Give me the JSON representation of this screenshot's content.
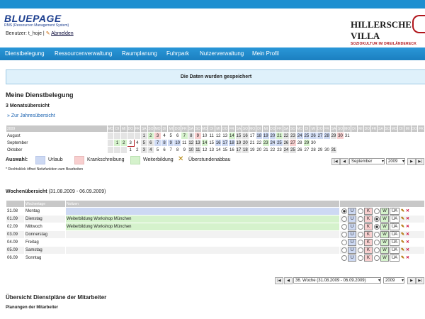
{
  "header": {
    "logo_text": "BLUEPAGE",
    "logo_sub": "RMS (Ressourcen Management System)",
    "user_label": "Benutzer: t_hoje |",
    "logout_label": "Abmelden",
    "brand_title": "HILLERSCHE VILLA",
    "brand_sub": "SOZIOKULTUR IM DREILÄNDERECK"
  },
  "nav": [
    "Dienstbelegung",
    "Ressourcenverwaltung",
    "Raumplanung",
    "Fuhrpark",
    "Nutzerverwaltung",
    "Mein Profil"
  ],
  "message": "Die Daten wurden gespeichert",
  "page_title": "Meine Dienstbelegung",
  "subtitle": "3 Monatsübersicht",
  "year_link": "» Zur Jahresübersicht",
  "calendar": {
    "year": "2009",
    "weekday_headers": [
      "MO",
      "DI",
      "MI",
      "DO",
      "FR",
      "SA",
      "SO",
      "MO",
      "DI",
      "MI",
      "DO",
      "FR",
      "SA",
      "SO",
      "MO",
      "DI",
      "MI",
      "DO",
      "FR",
      "SA",
      "SO",
      "MO",
      "DI",
      "MI",
      "DO",
      "FR",
      "SA",
      "SO",
      "MO",
      "DI",
      "MI",
      "DO",
      "FR",
      "SA",
      "SO",
      "MO",
      "DI",
      "MI",
      "DO",
      "FR",
      "SA",
      "SO"
    ],
    "months": [
      {
        "name": "August",
        "offset": 5,
        "days": 31
      },
      {
        "name": "September",
        "offset": 1,
        "days": 30
      },
      {
        "name": "Oktober",
        "offset": 3,
        "days": 31
      }
    ]
  },
  "legend": {
    "label": "Auswahl:",
    "items": [
      "Urlaub",
      "Krankschreibung",
      "Weiterbildung",
      "Überstundenabbau"
    ],
    "colors": {
      "urlaub": "#cdd9f3",
      "krank": "#f8cfcf",
      "weiter": "#d5f2cc"
    }
  },
  "note": "* Rechtsklick öffnet Notizfunktion zum Bearbeiten",
  "month_select": "September",
  "year_select": "2009",
  "week": {
    "title_bold": "Wochenübersicht",
    "title_range": "(31.08.2009 - 06.09.2009)",
    "col_weekday": "Wochentage",
    "col_notes": "Notizen",
    "rows": [
      {
        "date": "31.08",
        "day": "Montag",
        "note": "",
        "type": "u"
      },
      {
        "date": "01.09",
        "day": "Dienstag",
        "note": "Weiterbildung Workshop München",
        "type": "w"
      },
      {
        "date": "02.09",
        "day": "Mittwoch",
        "note": "Weiterbildung Workshop München",
        "type": "w"
      },
      {
        "date": "03.09",
        "day": "Donnerstag",
        "note": "",
        "type": ""
      },
      {
        "date": "04.09",
        "day": "Freitag",
        "note": "",
        "type": ""
      },
      {
        "date": "05.09",
        "day": "Samstag",
        "note": "",
        "type": ""
      },
      {
        "date": "06.09",
        "day": "Sonntag",
        "note": "",
        "type": ""
      }
    ],
    "tag_labels": [
      "U",
      "K",
      "W",
      "ÜA"
    ],
    "week_select": "36. Woche   (31.08.2009 - 06.09.2009)",
    "week_year_select": "2009"
  },
  "section2": "Übersicht Dienstpläne der Mitarbeiter",
  "section3": "Planungen der Mitarbeiter"
}
